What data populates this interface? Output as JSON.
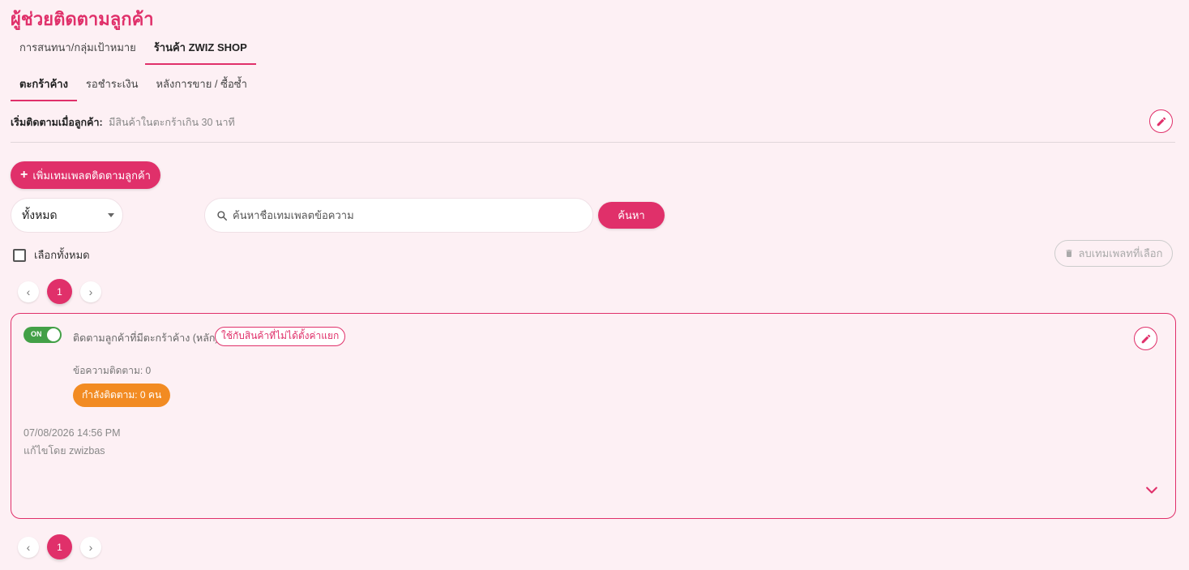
{
  "page": {
    "title": "ผู้ช่วยติดตามลูกค้า"
  },
  "tabs_primary": [
    {
      "label": "การสนทนา/กลุ่มเป้าหมาย",
      "active": false
    },
    {
      "label": "ร้านค้า ZWIZ SHOP",
      "active": true
    }
  ],
  "tabs_secondary": [
    {
      "label": "ตะกร้าค้าง",
      "active": true
    },
    {
      "label": "รอชำระเงิน",
      "active": false
    },
    {
      "label": "หลังการขาย / ซื้อซ้ำ",
      "active": false
    }
  ],
  "trigger": {
    "label": "เริ่มติดตามเมื่อลูกค้า:",
    "value": "มีสินค้าในตะกร้าเกิน 30 นาที"
  },
  "toolbar": {
    "add_label": "เพิ่มเทมเพลตติดตามลูกค้า",
    "filter_value": "ทั้งหมด",
    "search_placeholder": "ค้นหาชื่อเทมเพลตข้อความ",
    "search_value": "",
    "search_button": "ค้นหา",
    "select_all_label": "เลือกทั้งหมด",
    "delete_label": "ลบเทมเพลทที่เลือก"
  },
  "pagination": {
    "current_page": "1"
  },
  "templates": [
    {
      "toggle_label": "ON",
      "enabled": true,
      "title": "ติดตามลูกค้าที่มีตะกร้าค้าง (หลัก)",
      "scope_badge": "ใช้กับสินค้าที่ไม่ได้ตั้งค่าแยก",
      "message_count": "ข้อความติดตาม: 0",
      "following": "กำลังติดตาม: 0 คน",
      "date": "07/08/2026 14:56 PM",
      "edited_by": "แก้ไขโดย zwizbas"
    }
  ],
  "colors": {
    "accent": "#e0306a",
    "background": "#fdf0f4",
    "toggle_on": "#43a047",
    "following_badge": "#f28b22"
  },
  "icons": {
    "edit": "pencil-icon",
    "add": "plus-icon",
    "search": "search-icon",
    "delete": "trash-icon",
    "prev": "chevron-left-icon",
    "next": "chevron-right-icon",
    "expand": "chevron-down-icon"
  }
}
